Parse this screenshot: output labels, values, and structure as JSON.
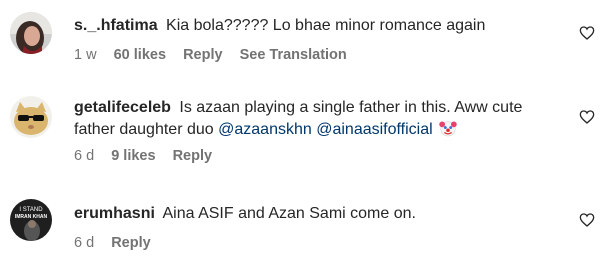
{
  "comments": [
    {
      "username": "s._.hfatima",
      "text": "Kia bola????? Lo bhae minor romance again",
      "time": "1 w",
      "likes": "60 likes",
      "reply": "Reply",
      "translate": "See Translation",
      "avatar_icon": "avatar-woman-photo"
    },
    {
      "username": "getalifeceleb",
      "text_line1": "Is azaan playing a single father in this. Aww cute",
      "text_line2_prefix": "father daughter duo",
      "mention1": "@azaanskhn",
      "mention2": "@ainaasifofficial",
      "emoji_icon": "clown-face-icon",
      "time": "6 d",
      "likes": "9 likes",
      "reply": "Reply",
      "avatar_icon": "avatar-cool-cat"
    },
    {
      "username": "erumhasni",
      "text": "Aina ASIF and Azan Sami come on.",
      "time": "6 d",
      "reply": "Reply",
      "avatar_icon": "avatar-poster",
      "avatar_text_1": "I STAND",
      "avatar_text_2": "IMRAN KHAN"
    }
  ],
  "colors": {
    "text": "#262626",
    "meta": "#737373",
    "mention": "#00376b"
  }
}
